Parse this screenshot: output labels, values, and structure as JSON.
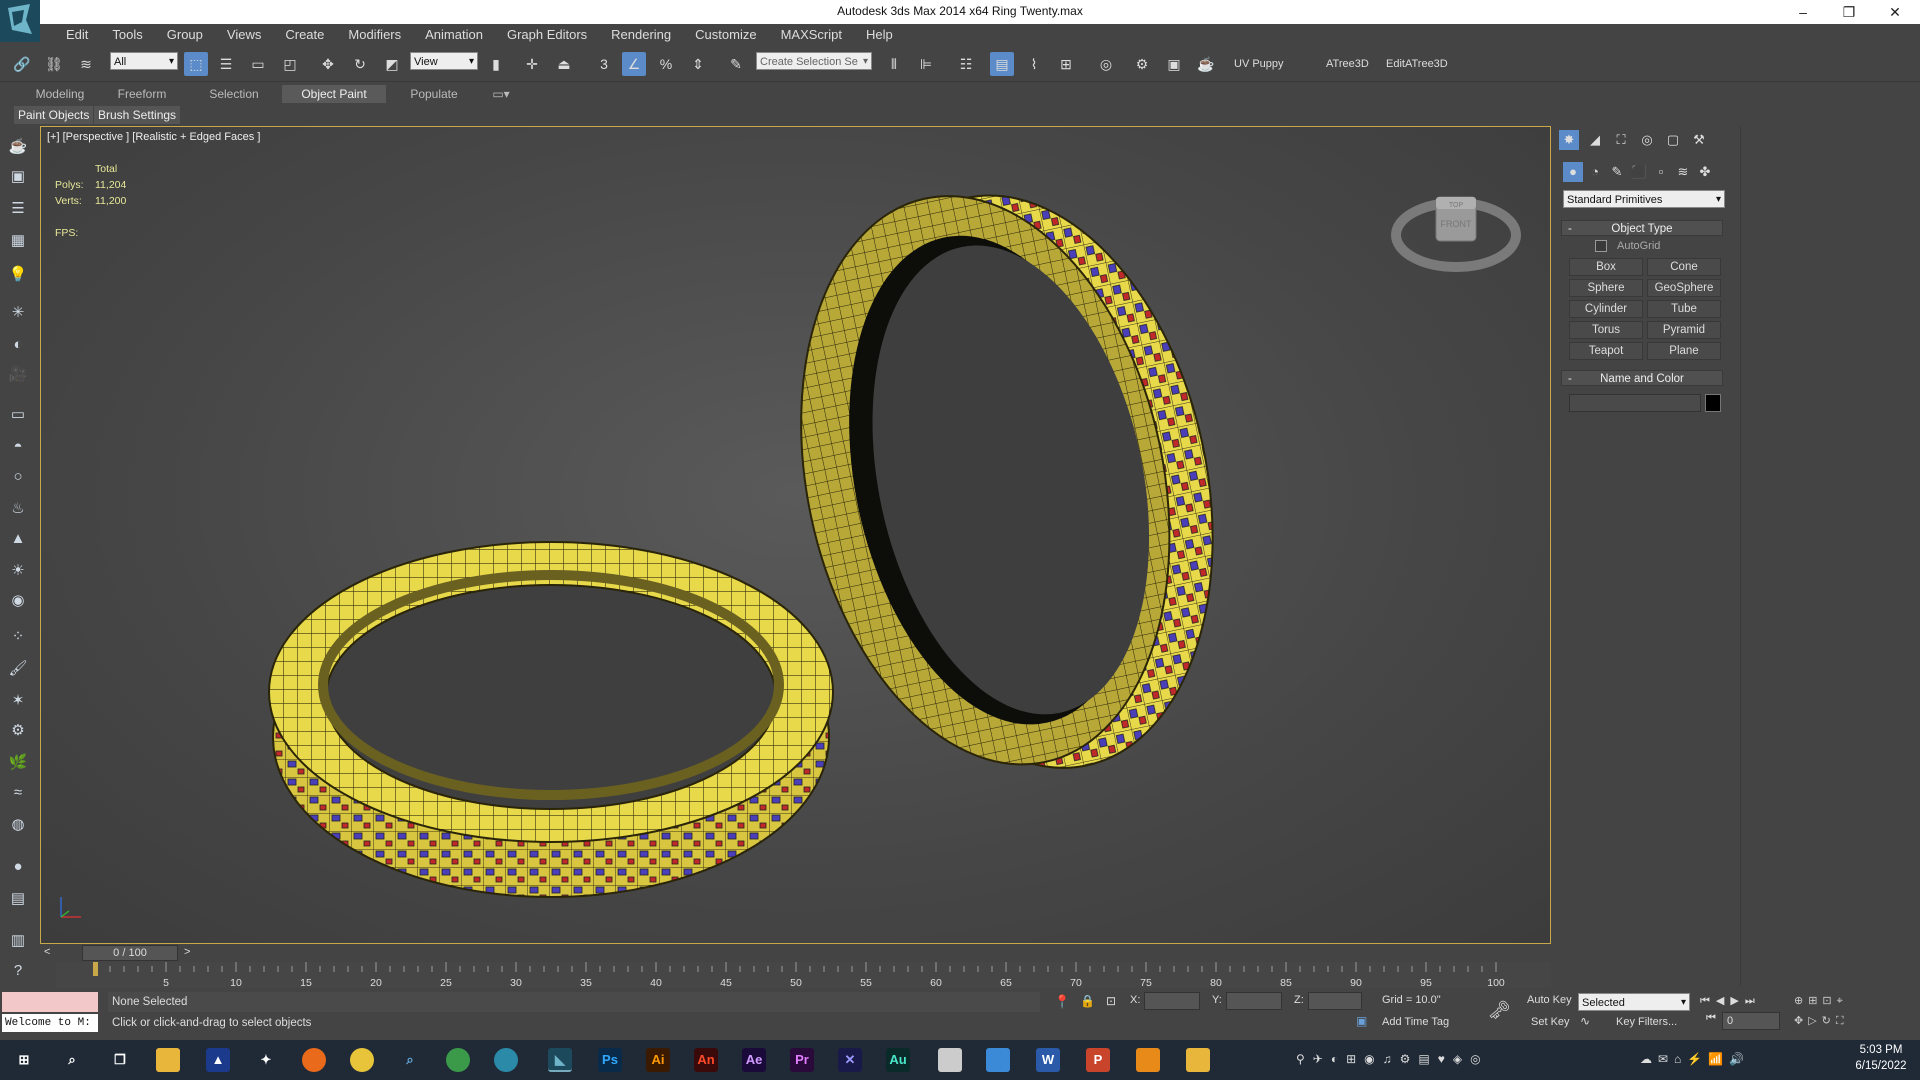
{
  "title": "Autodesk 3ds Max  2014 x64    Ring Twenty.max",
  "menu": [
    "Edit",
    "Tools",
    "Group",
    "Views",
    "Create",
    "Modifiers",
    "Animation",
    "Graph Editors",
    "Rendering",
    "Customize",
    "MAXScript",
    "Help"
  ],
  "toolbar": {
    "selection_filter": "All",
    "ref_coord": "View",
    "selection_set_placeholder": "Create Selection Se",
    "uv_puppy": "UV Puppy",
    "atree": "ATree3D",
    "edit_atree": "EditATree3D"
  },
  "ribbon_tabs": [
    "Modeling",
    "Freeform",
    "Selection",
    "Object Paint",
    "Populate"
  ],
  "ribbon_subtabs": [
    "Paint Objects",
    "Brush Settings"
  ],
  "viewport": {
    "label": "[+] [Perspective ] [Realistic + Edged Faces ]",
    "stats_total": "Total",
    "polys_label": "Polys:",
    "polys_value": "11,204",
    "verts_label": "Verts:",
    "verts_value": "11,200",
    "fps_label": "FPS:",
    "viewcube_face": "FRONT",
    "viewcube_top": "TOP"
  },
  "command_panel": {
    "category": "Standard Primitives",
    "object_type_header": "Object Type",
    "autogrid": "AutoGrid",
    "buttons": [
      "Box",
      "Cone",
      "Sphere",
      "GeoSphere",
      "Cylinder",
      "Tube",
      "Torus",
      "Pyramid",
      "Teapot",
      "Plane"
    ],
    "name_color_header": "Name and Color"
  },
  "timeline": {
    "frame_display": "0 / 100",
    "ticks": [
      "5",
      "10",
      "15",
      "20",
      "25",
      "30",
      "35",
      "40",
      "45",
      "50",
      "55",
      "60",
      "65",
      "70",
      "75",
      "80",
      "85",
      "90",
      "95",
      "100"
    ]
  },
  "status": {
    "maxscript": "Welcome to M:",
    "selection": "None Selected",
    "prompt": "Click or click-and-drag to select objects",
    "x_label": "X:",
    "y_label": "Y:",
    "z_label": "Z:",
    "grid": "Grid = 10.0\"",
    "add_time_tag": "Add Time Tag",
    "auto_key": "Auto Key",
    "auto_key_mode": "Selected",
    "set_key": "Set Key",
    "key_filters": "Key Filters...",
    "frame": "0"
  },
  "taskbar": {
    "time": "5:03 PM",
    "date": "6/15/2022",
    "apps": [
      "Ps",
      "Ai",
      "An",
      "Ae",
      "Pr",
      "Au",
      "W",
      "P"
    ]
  },
  "colors": {
    "accent": "#5b8bc9",
    "viewport_border": "#c8a94a",
    "stats_text": "#e8e89a",
    "ring_gold": "#e8d94a",
    "gem_blue": "#4a3fb8",
    "gem_red": "#c0282a"
  }
}
